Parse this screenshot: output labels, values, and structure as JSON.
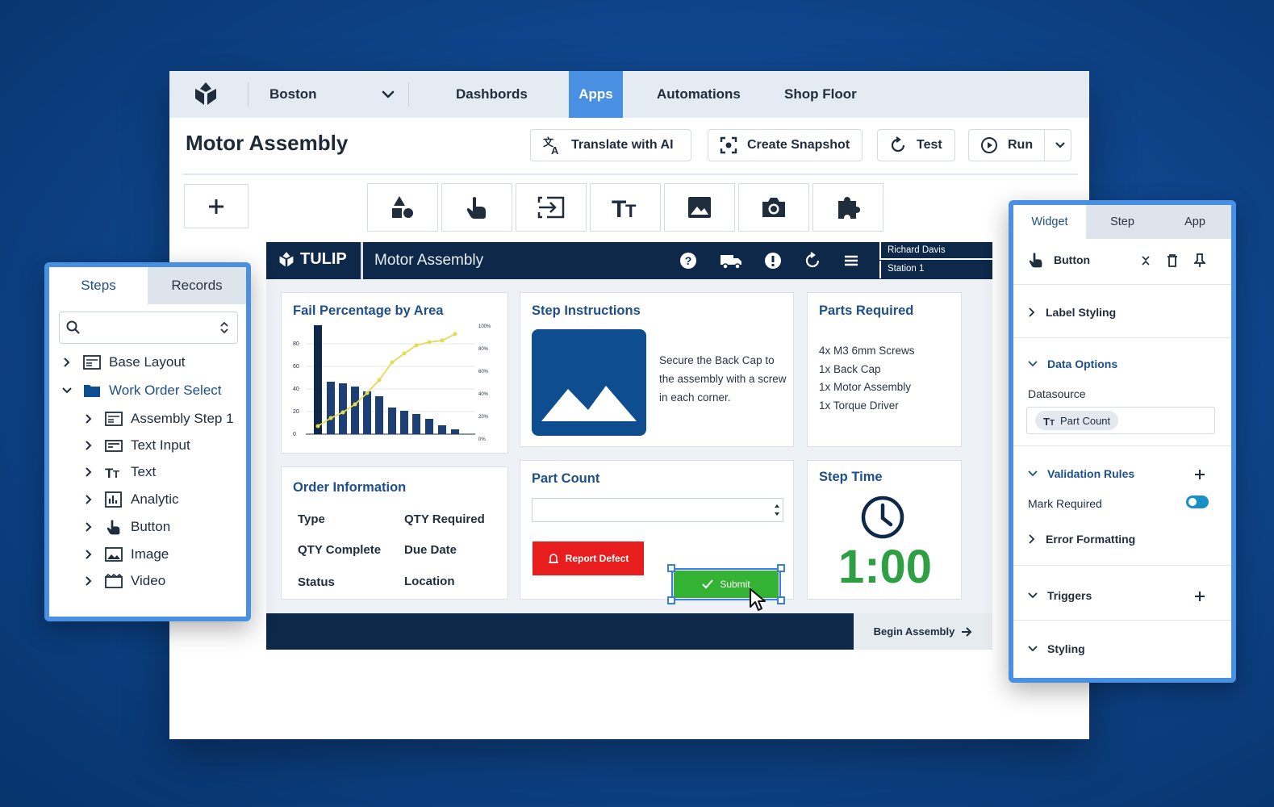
{
  "topnav": {
    "location": "Boston",
    "items": [
      "Dashbords",
      "Apps",
      "Automations",
      "Shop Floor"
    ],
    "active_item": "Apps"
  },
  "editor": {
    "app_title": "Motor Assembly",
    "buttons": {
      "translate": "Translate with AI",
      "snapshot": "Create Snapshot",
      "test": "Test",
      "run": "Run"
    }
  },
  "app": {
    "brand": "TULIP",
    "title": "Motor Assembly",
    "user": "Richard Davis",
    "station": "Station 1",
    "fail_chart": {
      "title": "Fail Percentage by Area",
      "left_ticks": [
        "80",
        "60",
        "40",
        "20",
        "0"
      ],
      "right_ticks": [
        "100%",
        "80%",
        "60%",
        "40%",
        "20%",
        "0%"
      ]
    },
    "step_instructions": {
      "title": "Step Instructions",
      "text": "Secure the Back Cap to the assembly with a screw in each corner."
    },
    "parts_required": {
      "title": "Parts Required",
      "items": [
        "4x M3 6mm Screws",
        "1x Back Cap",
        "1x Motor Assembly",
        "1x Torque Driver"
      ]
    },
    "order_info": {
      "title": "Order Information",
      "labels": [
        "Type",
        "QTY Required",
        "QTY Complete",
        "Due Date",
        "Status",
        "Location"
      ]
    },
    "part_count": {
      "title": "Part Count",
      "value": "",
      "report_defect": "Report Defect",
      "submit": "Submit"
    },
    "step_time": {
      "title": "Step Time",
      "value": "1:00"
    },
    "begin_assembly": "Begin Assembly"
  },
  "steps_panel": {
    "tabs": [
      "Steps",
      "Records"
    ],
    "active_tab": "Steps",
    "search_placeholder": "",
    "tree": [
      {
        "label": "Base Layout",
        "level": 0,
        "icon": "layout-icon",
        "expanded": false
      },
      {
        "label": "Work Order Select",
        "level": 0,
        "icon": "folder-icon",
        "expanded": true,
        "selected": true
      },
      {
        "label": "Assembly Step 1",
        "level": 1,
        "icon": "layout-icon"
      },
      {
        "label": "Text Input",
        "level": 1,
        "icon": "text-input-icon"
      },
      {
        "label": "Text",
        "level": 1,
        "icon": "text-icon"
      },
      {
        "label": "Analytic",
        "level": 1,
        "icon": "analytic-icon"
      },
      {
        "label": "Button",
        "level": 1,
        "icon": "pointer-hand-icon"
      },
      {
        "label": "Image",
        "level": 1,
        "icon": "image-icon"
      },
      {
        "label": "Video",
        "level": 1,
        "icon": "video-icon"
      }
    ]
  },
  "props_panel": {
    "tabs": [
      "Widget",
      "Step",
      "App"
    ],
    "active_tab": "Widget",
    "widget_name": "Button",
    "sections": {
      "label_styling": "Label Styling",
      "data_options": "Data Options",
      "datasource_label": "Datasource",
      "datasource_value": "Part Count",
      "validation_rules": "Validation Rules",
      "mark_required": "Mark Required",
      "error_formatting": "Error Formatting",
      "triggers": "Triggers",
      "styling": "Styling"
    }
  },
  "colors": {
    "accent": "#4a90e2",
    "brand_navy": "#0d2848",
    "title_blue": "#1e4f8a",
    "defect_red": "#e81e1e",
    "submit_green": "#34b233",
    "timer_green": "#2ea043"
  }
}
